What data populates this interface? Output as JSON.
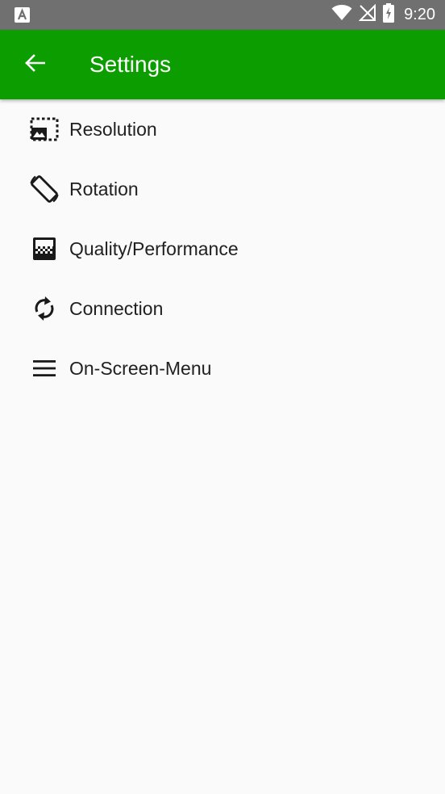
{
  "status_bar": {
    "time": "9:20",
    "notification_icon": "a-letter-notification-icon",
    "wifi_icon": "wifi-icon",
    "signal_icon": "no-signal-icon",
    "battery_icon": "battery-charging-icon"
  },
  "app_bar": {
    "title": "Settings",
    "back_icon": "arrow-back-icon",
    "color": "#0c9e01"
  },
  "settings": {
    "items": [
      {
        "label": "Resolution",
        "icon": "resolution-icon"
      },
      {
        "label": "Rotation",
        "icon": "rotation-icon"
      },
      {
        "label": "Quality/Performance",
        "icon": "quality-icon"
      },
      {
        "label": "Connection",
        "icon": "connection-sync-icon"
      },
      {
        "label": "On-Screen-Menu",
        "icon": "menu-icon"
      }
    ]
  }
}
